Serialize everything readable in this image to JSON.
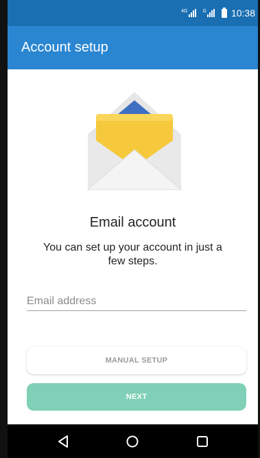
{
  "status_bar": {
    "signal1_tag": "4G",
    "signal2_tag": "G",
    "time": "10:38",
    "icons": [
      "signal-icon",
      "signal-icon",
      "battery-icon"
    ]
  },
  "app_bar": {
    "title": "Account setup"
  },
  "illustration": {
    "icon": "envelope-icon"
  },
  "main": {
    "title": "Email account",
    "subtitle": "You can set up your account in just a few steps."
  },
  "form": {
    "email_placeholder": "Email address",
    "email_value": ""
  },
  "buttons": {
    "manual_setup": "MANUAL SETUP",
    "next": "NEXT"
  },
  "nav_bar": {
    "icons": [
      "back-icon",
      "home-icon",
      "recents-icon"
    ]
  },
  "colors": {
    "status_bar": "#1a6fb3",
    "app_bar": "#2a86d1",
    "next_button": "#7fd0b6"
  }
}
